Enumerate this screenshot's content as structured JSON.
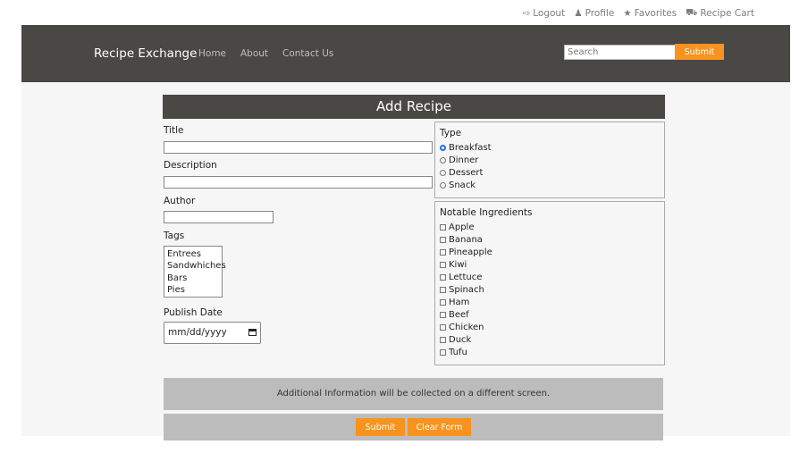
{
  "top_links": [
    {
      "icon": "logout-icon",
      "glyph": "⇨",
      "label": "Logout"
    },
    {
      "icon": "profile-icon",
      "glyph": "♟",
      "label": "Profile"
    },
    {
      "icon": "star-icon",
      "glyph": "★",
      "label": "Favorites"
    },
    {
      "icon": "cart-icon",
      "glyph": "⛟",
      "label": "Recipe Cart"
    }
  ],
  "navbar": {
    "brand": "Recipe Exchange",
    "links": [
      "Home",
      "About",
      "Contact Us"
    ],
    "search_placeholder": "Search",
    "submit_label": "Submit"
  },
  "form": {
    "title": "Add Recipe",
    "title_label": "Title",
    "description_label": "Description",
    "author_label": "Author",
    "tags_label": "Tags",
    "tags": [
      "Entrees",
      "Sandwhiches",
      "Bars",
      "Pies"
    ],
    "publish_date_label": "Publish Date",
    "publish_date_placeholder": "mm/dd/yyyy",
    "type_legend": "Type",
    "types": [
      "Breakfast",
      "Dinner",
      "Dessert",
      "Snack"
    ],
    "selected_type": "Breakfast",
    "ingredients_legend": "Notable Ingredients",
    "ingredients": [
      "Apple",
      "Banana",
      "Pineapple",
      "Kiwi",
      "Lettuce",
      "Spinach",
      "Ham",
      "Beef",
      "Chicken",
      "Duck",
      "Tufu"
    ],
    "info_text": "Additional Information will be collected on a different screen.",
    "submit_label": "Submit",
    "clear_label": "Clear Form"
  },
  "colors": {
    "navbar": "#4a4844",
    "accent": "#f7931e",
    "panel": "#bcbcbc"
  }
}
